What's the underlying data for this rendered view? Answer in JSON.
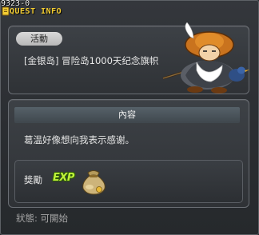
{
  "window": {
    "quest_id": "9323-0",
    "title": "QUEST INFO"
  },
  "quest": {
    "category": "活動",
    "name": "[金银岛] 冒险岛1000天纪念旗帜"
  },
  "content": {
    "header": "內容",
    "text": "葛温好像想向我表示感谢。"
  },
  "reward": {
    "label": "獎勵",
    "exp_text": "EXP"
  },
  "status": {
    "label": "狀態:",
    "value": "可開始"
  },
  "icons": {
    "title": "quest-info-icon",
    "npc": "npc-portrait-icon",
    "exp": "exp-icon",
    "meso": "money-bag-icon"
  },
  "colors": {
    "title": "#f2cc33",
    "exp": "#bff23a",
    "header_bar": "#4b555c",
    "tag": "#cfcfcf"
  }
}
